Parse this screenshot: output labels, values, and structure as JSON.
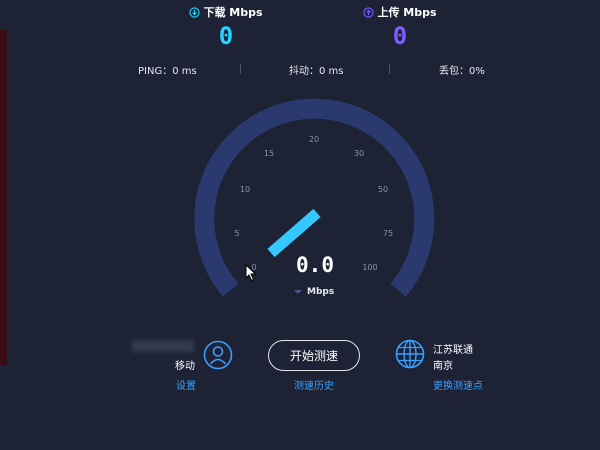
{
  "download": {
    "label": "下载 Mbps",
    "value": "0",
    "icon": "download-icon",
    "color": "#2ad3ff"
  },
  "upload": {
    "label": "上传 Mbps",
    "value": "0",
    "icon": "upload-icon",
    "color": "#7b5cff"
  },
  "stats": {
    "ping": "PING：0 ms",
    "jitter": "抖动：0 ms",
    "loss": "丢包：0%"
  },
  "gauge": {
    "ticks": [
      "0",
      "5",
      "10",
      "15",
      "20",
      "30",
      "50",
      "75",
      "100"
    ],
    "value": "0.0",
    "unit": "Mbps"
  },
  "bottom": {
    "isp": "移动",
    "settings": "设置",
    "start_button": "开始测速",
    "history": "测速历史",
    "server_name": "江苏联通",
    "server_city": "南京",
    "change_server": "更换测速点"
  },
  "colors": {
    "background": "#1d2235",
    "gauge_track": "#2a3a6e",
    "needle": "#2ad3ff",
    "link": "#39a0ff"
  }
}
